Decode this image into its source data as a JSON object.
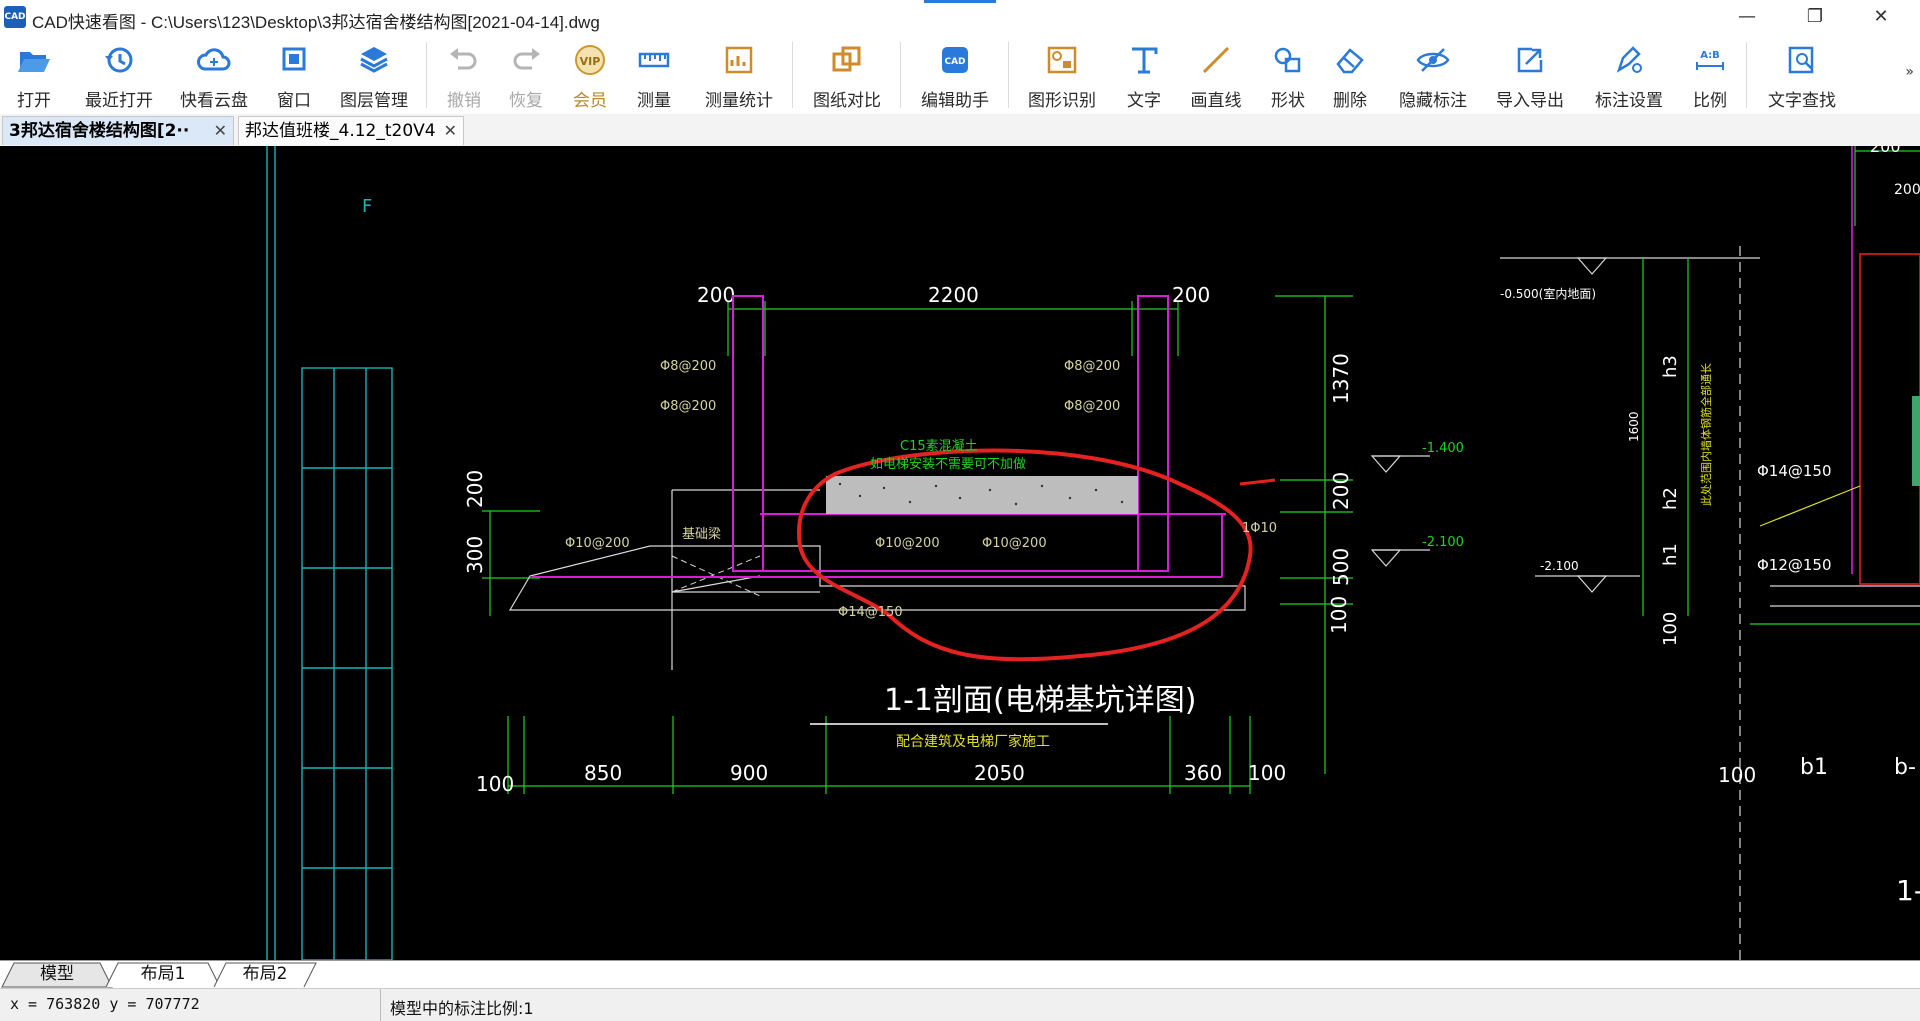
{
  "window": {
    "app_icon_text": "CAD",
    "title": "CAD快速看图 - C:\\Users\\123\\Desktop\\3邦达宿舍楼结构图[2021-04-14].dwg",
    "minimize": "—",
    "restore": "❐",
    "close": "✕"
  },
  "toolbar": {
    "items": [
      {
        "label": "打开",
        "icon": "folder-open-icon"
      },
      {
        "label": "最近打开",
        "icon": "history-icon"
      },
      {
        "label": "快看云盘",
        "icon": "cloud-icon"
      },
      {
        "label": "窗口",
        "icon": "window-icon"
      },
      {
        "label": "图层管理",
        "icon": "layers-icon"
      },
      {
        "label": "撤销",
        "icon": "undo-icon"
      },
      {
        "label": "恢复",
        "icon": "redo-icon"
      },
      {
        "label": "会员",
        "icon": "vip-icon"
      },
      {
        "label": "测量",
        "icon": "ruler-icon"
      },
      {
        "label": "测量统计",
        "icon": "measure-stats-icon"
      },
      {
        "label": "图纸对比",
        "icon": "compare-icon"
      },
      {
        "label": "编辑助手",
        "icon": "edit-assistant-icon"
      },
      {
        "label": "图形识别",
        "icon": "shape-recognize-icon"
      },
      {
        "label": "文字",
        "icon": "text-icon"
      },
      {
        "label": "画直线",
        "icon": "line-icon"
      },
      {
        "label": "形状",
        "icon": "shapes-icon"
      },
      {
        "label": "删除",
        "icon": "eraser-icon"
      },
      {
        "label": "隐藏标注",
        "icon": "eye-hide-icon"
      },
      {
        "label": "导入导出",
        "icon": "import-export-icon"
      },
      {
        "label": "标注设置",
        "icon": "annotation-settings-icon"
      },
      {
        "label": "比例",
        "icon": "scale-icon"
      },
      {
        "label": "文字查找",
        "icon": "text-search-icon"
      }
    ],
    "vip_badge": "VIP",
    "cad_badge": "CAD",
    "scale_badge": "A:B",
    "more": "»"
  },
  "doc_tabs": [
    {
      "label": "3邦达宿舍楼结构图[2··",
      "active": true
    },
    {
      "label": "邦达值班楼_4.12_t20V4",
      "active": false
    }
  ],
  "tab_close": "✕",
  "drawing": {
    "grid_label": "F",
    "dims_top": [
      "200",
      "2200",
      "200"
    ],
    "dims_bottom": [
      "100",
      "850",
      "900",
      "2050",
      "360",
      "100"
    ],
    "dims_right": [
      "1370",
      "200",
      "500",
      "100"
    ],
    "dims_left": [
      "200",
      "300"
    ],
    "rebar_labels": [
      "Φ8@200",
      "Φ8@200",
      "Φ8@200",
      "Φ8@200",
      "Φ10@200",
      "Φ10@200",
      "Φ10@200",
      "Φ14@150",
      "1Φ10"
    ],
    "concrete_note_1": "C15素混凝土",
    "concrete_note_2": "如电梯安装不需要可不加做",
    "beam_note": "基础梁",
    "level_1": "-1.400",
    "level_2": "-2.100",
    "title": "1-1剖面(电梯基坑详图)",
    "subtitle": "配合建筑及电梯厂家施工",
    "right_top_dim": "200",
    "right_top_dim2": "200",
    "right_level_top": "-0.500(室内地面)",
    "right_level_bottom": "-2.100",
    "right_vertical_dim": "1600",
    "right_h_labels": [
      "h3",
      "h2",
      "h1"
    ],
    "right_rebar": [
      "Φ14@150",
      "Φ12@150"
    ],
    "right_note": "此处范围内墙体钢筋全部通长",
    "right_dim_bottom": [
      "100",
      "100",
      "b1",
      "b-"
    ],
    "right_title_fragment": "1-"
  },
  "layout_tabs": [
    "模型",
    "布局1",
    "布局2"
  ],
  "status": {
    "coords": "x = 763820 y = 707772",
    "scale_text": "模型中的标注比例:1"
  }
}
